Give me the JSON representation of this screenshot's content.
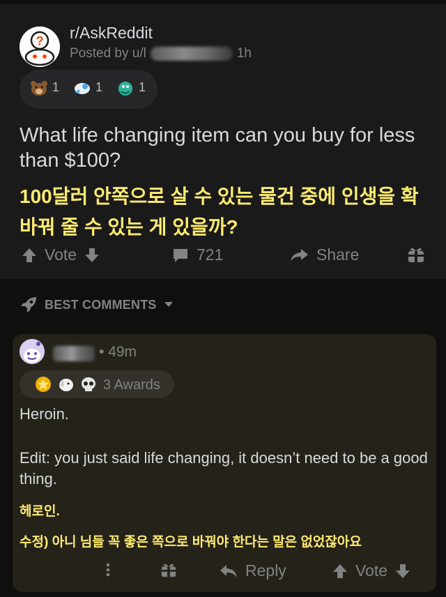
{
  "post": {
    "subreddit": "r/AskReddit",
    "posted_by_prefix": "Posted by u/l",
    "time": "1h",
    "awards": [
      {
        "icon": "bear-award-icon",
        "count": "1"
      },
      {
        "icon": "rocket-award-icon",
        "count": "1"
      },
      {
        "icon": "dragon-award-icon",
        "count": "1"
      }
    ],
    "title": "What life changing item can you buy for less than $100?",
    "title_translation": "100달러 안쪽으로 살 수 있는 물건 중에 인생을 확 바꿔 줄 수 있는 게 있을까?",
    "vote_label": "Vote",
    "comment_count": "721",
    "share_label": "Share"
  },
  "sort": {
    "label": "BEST COMMENTS"
  },
  "comment": {
    "time": "49m",
    "awards_label": "3 Awards",
    "body_line1": "Heroin.",
    "body_line2": "Edit: you just said life changing, it doesn’t need to be a good thing.",
    "translation_line1": "헤로인.",
    "translation_line2": "수정) 아니 님들 꼭 좋은 쪽으로 바꿔야 한다는 말은 없었잖아요",
    "reply_label": "Reply",
    "vote_label": "Vote"
  },
  "colors": {
    "background": "#0f0f0f",
    "card": "#1a1a1b",
    "comment_highlight": "#25221a",
    "translation_text": "#ffec6e",
    "muted_text": "#818384"
  }
}
